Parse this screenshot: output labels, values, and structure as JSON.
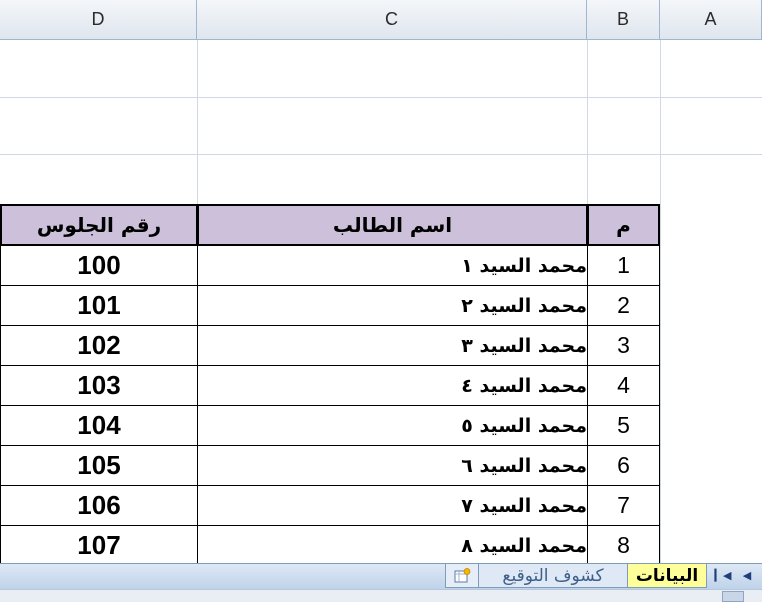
{
  "columns": [
    "D",
    "C",
    "B",
    "A"
  ],
  "table": {
    "headers": {
      "num": "م",
      "name": "اسم الطالب",
      "seat": "رقم الجلوس"
    },
    "rows": [
      {
        "num": "1",
        "name": "محمد السيد ١",
        "seat": "100"
      },
      {
        "num": "2",
        "name": "محمد السيد ٢",
        "seat": "101"
      },
      {
        "num": "3",
        "name": "محمد السيد ٣",
        "seat": "102"
      },
      {
        "num": "4",
        "name": "محمد السيد ٤",
        "seat": "103"
      },
      {
        "num": "5",
        "name": "محمد السيد ٥",
        "seat": "104"
      },
      {
        "num": "6",
        "name": "محمد السيد ٦",
        "seat": "105"
      },
      {
        "num": "7",
        "name": "محمد السيد ٧",
        "seat": "106"
      },
      {
        "num": "8",
        "name": "محمد السيد ٨",
        "seat": "107"
      }
    ],
    "header_color": "#ccc0da"
  },
  "sheet_tabs": {
    "active": "البيانات",
    "other": "كشوف التوقيع",
    "active_color": "#ffff99"
  },
  "icons": {
    "first_sheet": "first-sheet-icon",
    "prev_sheet": "prev-sheet-icon",
    "insert_sheet": "insert-sheet-icon"
  }
}
